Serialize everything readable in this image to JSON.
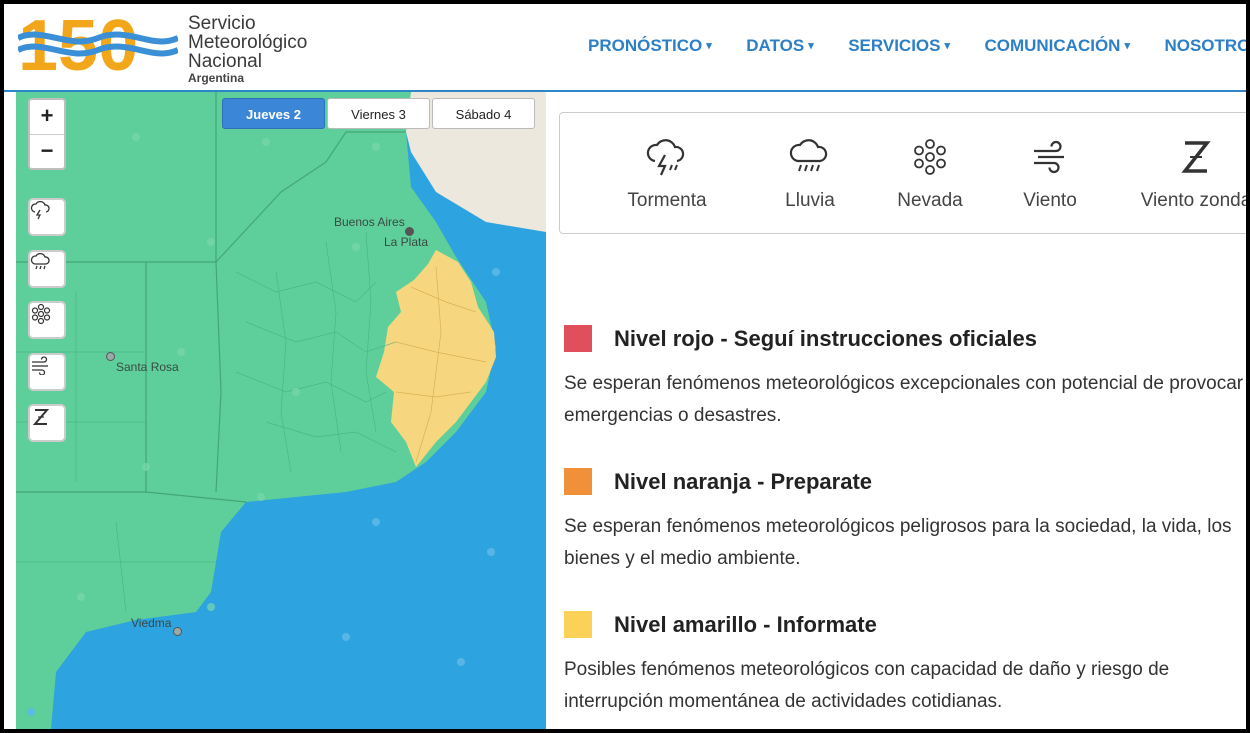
{
  "header": {
    "logo_number": "150",
    "logo_lines": [
      "Servicio",
      "Meteorológico",
      "Nacional"
    ],
    "logo_country": "Argentina",
    "nav": [
      {
        "label": "PRONÓSTICO"
      },
      {
        "label": "DATOS"
      },
      {
        "label": "SERVICIOS"
      },
      {
        "label": "COMUNICACIÓN"
      },
      {
        "label": "NOSOTROS"
      }
    ]
  },
  "map": {
    "zoom_in": "+",
    "zoom_out": "−",
    "day_tabs": [
      {
        "label": "Jueves 2",
        "active": true
      },
      {
        "label": "Viernes 3",
        "active": false
      },
      {
        "label": "Sábado 4",
        "active": false
      }
    ],
    "cities": [
      "Buenos Aires",
      "La Plata",
      "Santa Rosa",
      "Viedma"
    ],
    "side_icons": [
      "storm-icon",
      "rain-icon",
      "snow-icon",
      "wind-icon",
      "zonda-icon"
    ],
    "colors": {
      "land": "#5ecf9a",
      "alert_yellow": "#f6d77f",
      "sea": "#2da3e0",
      "uruguay": "#ede8de"
    }
  },
  "phenomena": [
    {
      "label": "Tormenta",
      "icon": "storm-icon"
    },
    {
      "label": "Lluvia",
      "icon": "rain-icon"
    },
    {
      "label": "Nevada",
      "icon": "snow-icon"
    },
    {
      "label": "Viento",
      "icon": "wind-icon"
    },
    {
      "label": "Viento zonda",
      "icon": "zonda-icon"
    }
  ],
  "levels": [
    {
      "title": "Nivel rojo - Seguí instrucciones oficiales",
      "color": "#e0505c",
      "desc": "Se esperan fenómenos meteorológicos excepcionales con potencial de provocar emergencias o desastres."
    },
    {
      "title": "Nivel naranja - Preparate",
      "color": "#f0913a",
      "desc": "Se esperan fenómenos meteorológicos peligrosos para la sociedad, la vida, los bienes y el medio ambiente."
    },
    {
      "title": "Nivel amarillo - Informate",
      "color": "#fcd157",
      "desc": "Posibles fenómenos meteorológicos con capacidad de daño y riesgo de interrupción momentánea de actividades cotidianas."
    }
  ]
}
